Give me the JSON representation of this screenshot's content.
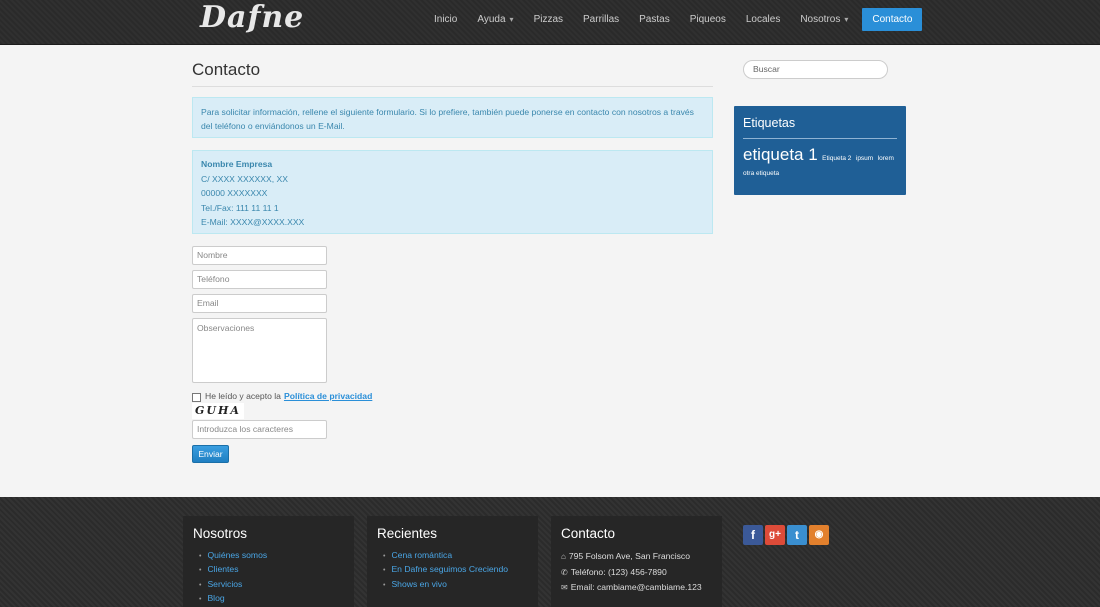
{
  "header": {
    "logo": "Dafne",
    "nav": [
      {
        "label": "Inicio"
      },
      {
        "label": "Ayuda",
        "has_dropdown": true
      },
      {
        "label": "Pizzas"
      },
      {
        "label": "Parrillas"
      },
      {
        "label": "Pastas"
      },
      {
        "label": "Piqueos"
      },
      {
        "label": "Locales"
      },
      {
        "label": "Nosotros",
        "has_dropdown": true
      },
      {
        "label": "Contacto",
        "active": true
      }
    ],
    "accent_color": "#2a8fd8"
  },
  "main": {
    "title": "Contacto",
    "info_text": "Para solicitar información, rellene el siguiente formulario. Si lo prefiere, también puede ponerse en contacto con nosotros a través del teléfono o enviándonos un E-Mail.",
    "address": {
      "name": "Nombre Empresa",
      "street": "C/ XXXX XXXXXX, XX",
      "city": "00000 XXXXXXX",
      "phone": "Tel./Fax: 111 11 11 1",
      "email": "E-Mail: XXXX@XXXX.XXX"
    },
    "form": {
      "name_placeholder": "Nombre",
      "phone_placeholder": "Teléfono",
      "email_placeholder": "Email",
      "notes_placeholder": "Observaciones",
      "privacy_text": "He leído y acepto la",
      "privacy_link": "Política de privacidad",
      "captcha_text": "GUHA",
      "captcha_placeholder": "Introduzca los caracteres",
      "submit_label": "Enviar"
    }
  },
  "sidebar": {
    "search_placeholder": "Buscar",
    "tags_title": "Etiquetas",
    "tags": {
      "big": "etiqueta 1",
      "small1": "Etiqueta 2",
      "small2": "ipsum",
      "small3": "lorem",
      "small4": "otra etiqueta"
    },
    "tags_bg": "#1f5f96"
  },
  "footer": {
    "col1": {
      "title": "Nosotros",
      "items": [
        "Quiénes somos",
        "Clientes",
        "Servicios",
        "Blog"
      ]
    },
    "col2": {
      "title": "Recientes",
      "items": [
        "Cena romántica",
        "En Dafne seguimos Creciendo",
        "Shows en vivo"
      ]
    },
    "col3": {
      "title": "Contacto",
      "address": "795 Folsom Ave, San Francisco",
      "phone": "Teléfono: (123) 456-7890",
      "email": "Email: cambiame@cambiame.123"
    },
    "social": [
      {
        "icon": "facebook-icon",
        "glyph": "f",
        "color": "#3b5998"
      },
      {
        "icon": "google-plus-icon",
        "glyph": "g+",
        "color": "#dd4b39"
      },
      {
        "icon": "twitter-icon",
        "glyph": "t",
        "color": "#3a8fd0"
      },
      {
        "icon": "rss-icon",
        "glyph": "◉",
        "color": "#e2802d"
      }
    ]
  }
}
